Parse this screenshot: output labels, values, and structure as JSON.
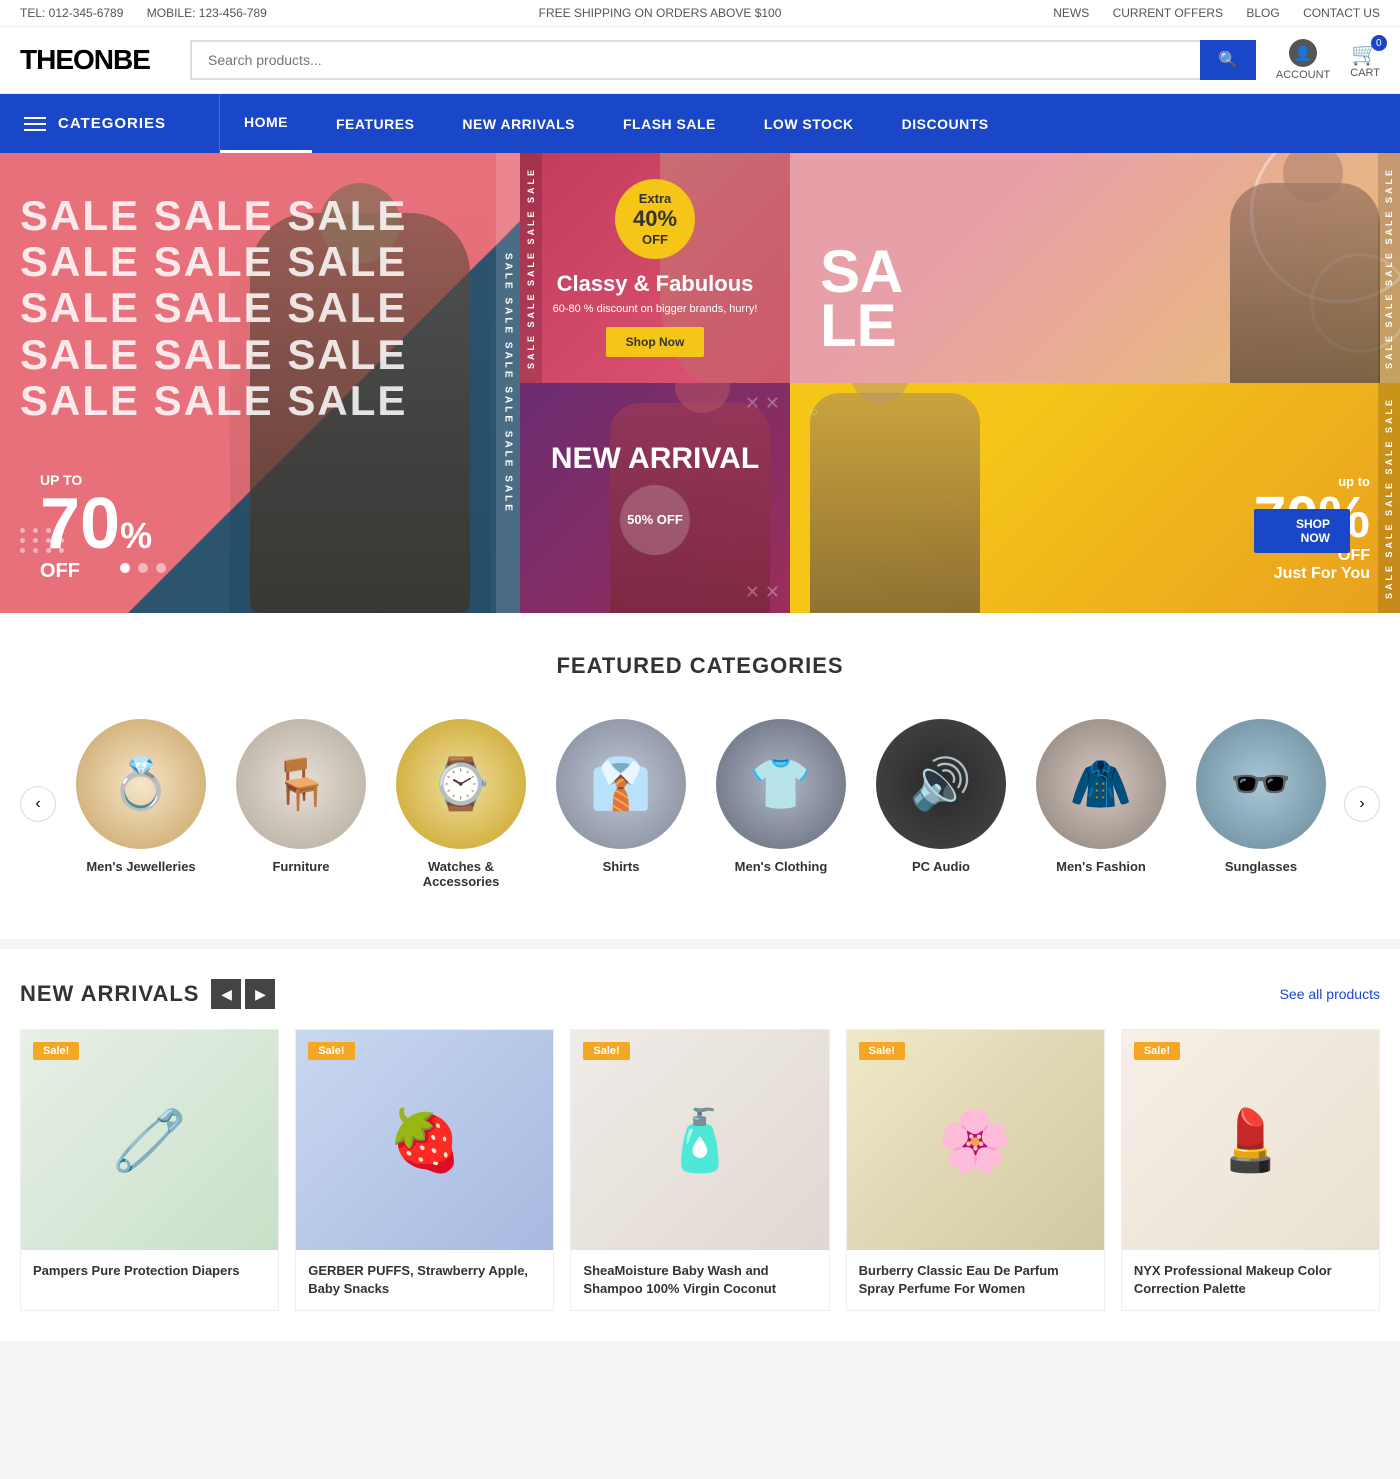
{
  "topbar": {
    "tel": "TEL: 012-345-6789",
    "mobile": "MOBILE: 123-456-789",
    "promo": "FREE SHIPPING ON ORDERS ABOVE $100",
    "links": [
      "NEWS",
      "CURRENT OFFERS",
      "BLOG",
      "CONTACT US"
    ]
  },
  "header": {
    "logo": "THEONBE",
    "search_placeholder": "Search products...",
    "account_label": "ACCOUNT",
    "cart_label": "CART",
    "cart_count": "0"
  },
  "nav": {
    "categories_label": "CATEGORIES",
    "links": [
      "HOME",
      "FEATURES",
      "NEW ARRIVALS",
      "FLASH SALE",
      "LOW STOCK",
      "DISCOUNTS"
    ],
    "active_index": 0
  },
  "hero": {
    "main": {
      "sale_text": "SALE SALE SALE SALE SALE SALE SALE SALE SALE SALE SALE SALE SALE SALE SALE",
      "up_to": "UP TO",
      "percent": "70",
      "off": "% OFF"
    },
    "banner_classy": {
      "badge_extra": "Extra",
      "badge_percent": "40%",
      "badge_off": "OFF",
      "title": "Classy & Fabulous",
      "subtitle": "60-80 % discount on bigger brands, hurry!",
      "button": "Shop Now"
    },
    "banner_sale2": {
      "sale": "SA",
      "le": "LE"
    },
    "banner_new": {
      "title": "NEW ARRIVAL",
      "badge": "50% OFF"
    },
    "banner_just": {
      "up_to": "up to",
      "percent": "70%",
      "off": "OFF",
      "tagline": "Just For You",
      "button": "SHOP NOW"
    }
  },
  "featured": {
    "title": "FEATURED CATEGORIES",
    "categories": [
      {
        "label": "Men's Jewelleries",
        "class": "cat-jewellery",
        "icon": "💍"
      },
      {
        "label": "Furniture",
        "class": "cat-furniture",
        "icon": "🪑"
      },
      {
        "label": "Watches & Accessories",
        "class": "cat-watches",
        "icon": "⌚"
      },
      {
        "label": "Shirts",
        "class": "cat-shirts",
        "icon": "👔"
      },
      {
        "label": "Men's Clothing",
        "class": "cat-clothing",
        "icon": "👕"
      },
      {
        "label": "PC Audio",
        "class": "cat-audio",
        "icon": "🔊"
      },
      {
        "label": "Men's Fashion",
        "class": "cat-fashion",
        "icon": "🧥"
      },
      {
        "label": "Sunglasses",
        "class": "cat-sunglasses",
        "icon": "🕶️"
      }
    ]
  },
  "new_arrivals": {
    "title": "NEW ARRIVALS",
    "see_all": "See all products",
    "prev_label": "◀",
    "next_label": "▶",
    "products": [
      {
        "name": "Pampers Pure Protection Diapers",
        "badge": "Sale!",
        "class": "prod-pampers",
        "icon": "🧷",
        "emoji_size": "64px"
      },
      {
        "name": "GERBER PUFFS, Strawberry Apple, Baby Snacks",
        "badge": "Sale!",
        "class": "prod-gerber",
        "icon": "🍓",
        "emoji_size": "64px"
      },
      {
        "name": "SheaMoisture Baby Wash and Shampoo 100% Virgin Coconut",
        "badge": "Sale!",
        "class": "prod-shea",
        "icon": "🧴",
        "emoji_size": "64px"
      },
      {
        "name": "Burberry Classic Eau De Parfum Spray Perfume For Women",
        "badge": "Sale!",
        "class": "prod-burberry",
        "icon": "🌸",
        "emoji_size": "64px"
      },
      {
        "name": "NYX Professional Makeup Color Correction Palette",
        "badge": "Sale!",
        "class": "prod-nyx",
        "icon": "💄",
        "emoji_size": "64px"
      }
    ]
  }
}
